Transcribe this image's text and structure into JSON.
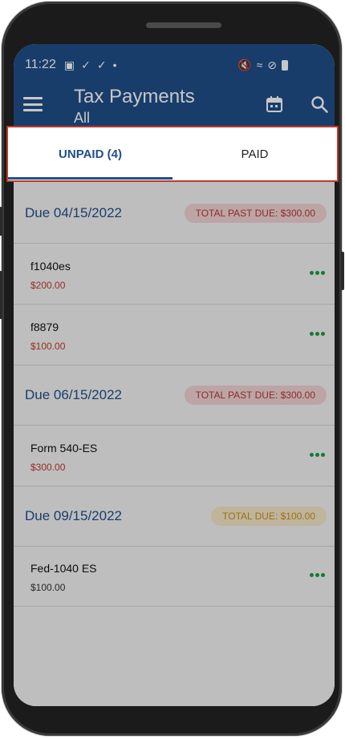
{
  "status_bar": {
    "time": "11:22"
  },
  "app_bar": {
    "title": "Tax Payments",
    "subtitle": "All"
  },
  "tabs": [
    {
      "label": "UNPAID (4)",
      "selected": true
    },
    {
      "label": "PAID",
      "selected": false
    }
  ],
  "groups": [
    {
      "date": "Due 04/15/2022",
      "badge": "TOTAL PAST DUE: $300.00",
      "items": [
        {
          "name": "f1040es",
          "amount": "$200.00"
        },
        {
          "name": "f8879",
          "amount": "$100.00"
        }
      ]
    },
    {
      "date": "Due 06/15/2022",
      "badge": "TOTAL PAST DUE: $300.00",
      "items": [
        {
          "name": "Form 540-ES",
          "amount": "$300.00"
        }
      ]
    },
    {
      "date": "Due 09/15/2022",
      "badge": "TOTAL DUE: $100.00",
      "items": [
        {
          "name": "Fed-1040 ES",
          "amount": "$100.00"
        }
      ]
    }
  ],
  "colors": {
    "primary": "#1f4f8a",
    "past_due_text": "#b53838",
    "past_due_bg": "#f2d4d4",
    "due_text": "#c8901c",
    "due_bg": "#f5e7c8",
    "more_dots": "#1a9a4a",
    "highlight_border": "#c0392b"
  },
  "icons": {
    "menu": "menu-icon",
    "calendar": "calendar-icon",
    "search": "search-icon",
    "more": "more-horizontal-icon"
  }
}
